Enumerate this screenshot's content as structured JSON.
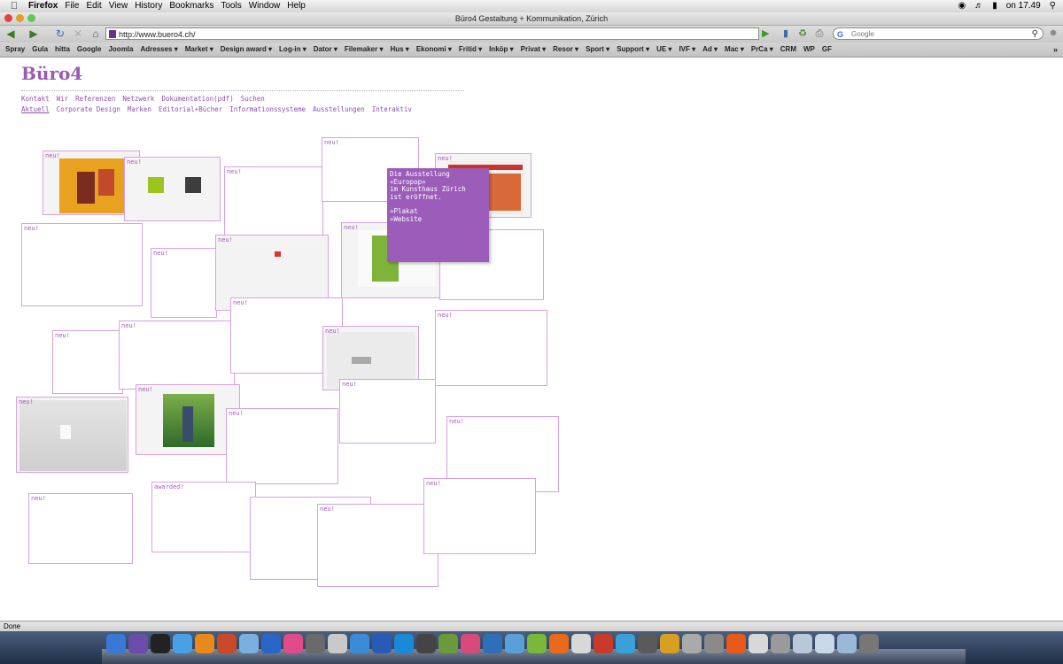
{
  "os_menubar": {
    "app": "Firefox",
    "menus": [
      "File",
      "Edit",
      "View",
      "History",
      "Bookmarks",
      "Tools",
      "Window",
      "Help"
    ],
    "clock": "on 17.49"
  },
  "window": {
    "title": "Büro4 Gestaltung + Kommunikation, Zürich"
  },
  "toolbar": {
    "url": "http://www.buero4.ch/",
    "search_placeholder": "Google"
  },
  "bookmarks": [
    "Spray",
    "Gula",
    "hitta",
    "Google",
    "Joomla",
    "Adresses ▾",
    "Market ▾",
    "Design award ▾",
    "Log-in ▾",
    "Dator ▾",
    "Filemaker ▾",
    "Hus ▾",
    "Ekonomi ▾",
    "Fritid ▾",
    "Inköp ▾",
    "Privat ▾",
    "Resor ▾",
    "Sport ▾",
    "Support ▾",
    "UE ▾",
    "IVF ▾",
    "Ad ▾",
    "Mac ▾",
    "PrCa ▾",
    "CRM",
    "WP",
    "GF"
  ],
  "page": {
    "logo": "Büro4",
    "nav_primary": [
      "Kontakt",
      "Wir",
      "Referenzen",
      "Netzwerk",
      "Dokumentation(pdf)",
      "Suchen"
    ],
    "nav_secondary": [
      "Aktuell",
      "Corporate Design",
      "Marken",
      "Editorial+Bücher",
      "Informationssysteme",
      "Ausstellungen",
      "Interaktiv"
    ],
    "tile_label_new": "neu!",
    "tile_label_awarded": "awarded!",
    "popup": {
      "line1": "Die Ausstellung",
      "line2": "«Europop»",
      "line3": "im Kunsthaus Zürich",
      "line4": "ist eröffnet.",
      "link1": "»Plakat",
      "link2": "»Website"
    }
  },
  "status": "Done",
  "colors": {
    "accent": "#9b59b6",
    "tile_border": "#d9a0e4",
    "popup_bg": "#9b5cba"
  }
}
